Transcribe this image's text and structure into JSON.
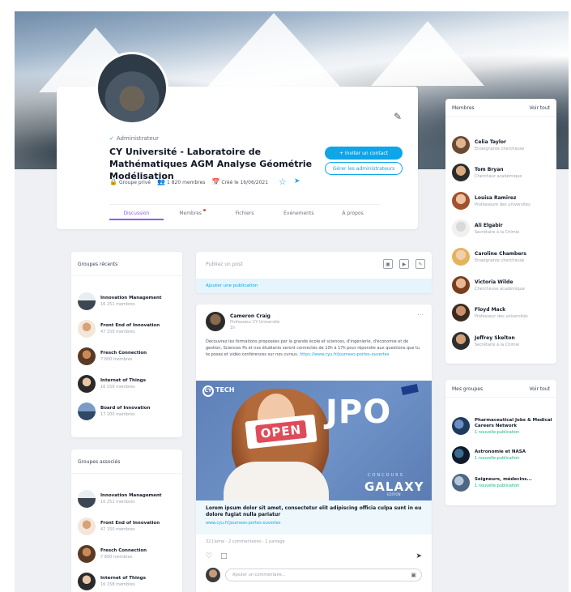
{
  "header": {
    "admin_label": "Administrateur",
    "title": "CY Université - Laboratoire de Mathématiques AGM Analyse Géométrie Modélisation",
    "meta": {
      "privacy": "Groupe privé",
      "members": "1 820 membres",
      "creation": "Créé le 16/06/2021"
    },
    "invite_button": "+ Inviter un contact",
    "admin_button": "Gérer les administrateurs",
    "tabs": [
      "Discussion",
      "Membres",
      "Fichiers",
      "Événements",
      "À propos"
    ]
  },
  "members_card": {
    "title": "Membres",
    "link": "Voir tout",
    "items": [
      {
        "name": "Celia Taylor",
        "role": "Enseignante chercheuse"
      },
      {
        "name": "Tom Bryan",
        "role": "Chercheur académique"
      },
      {
        "name": "Louisa Ramirez",
        "role": "Professeure des universités"
      },
      {
        "name": "Ali Elgabir",
        "role": "Secrétaire à la Chimie"
      },
      {
        "name": "Caroline Chambers",
        "role": "Enseignante chercheuse"
      },
      {
        "name": "Victoria Wilde",
        "role": "Chercheuse académique"
      },
      {
        "name": "Floyd Mack",
        "role": "Professeur des universités"
      },
      {
        "name": "Jeffrey Skelton",
        "role": "Secrétaire à la Chimie"
      }
    ]
  },
  "mygroups_card": {
    "title": "Mes groupes",
    "link": "Voir tout",
    "items": [
      {
        "name": "Pharmaceutical Jobs & Medical Careers Network",
        "sub": "1 nouvelle publication"
      },
      {
        "name": "Astronomie et NASA",
        "sub": "1 nouvelle publication"
      },
      {
        "name": "Seigneurs, médecins...",
        "sub": "1 nouvelle publication"
      }
    ]
  },
  "recent_groups": {
    "title": "Groupes récents",
    "items": [
      {
        "name": "Innovation Management",
        "count": "16 251 membres"
      },
      {
        "name": "Front End of Innovation",
        "count": "47 150 membres"
      },
      {
        "name": "Fresch Connection",
        "count": "7 800 membres"
      },
      {
        "name": "Internet of Things",
        "count": "16 158 membres"
      },
      {
        "name": "Board of Innovation",
        "count": "17 200 membres"
      }
    ]
  },
  "assoc_groups": {
    "title": "Groupes associés",
    "items": [
      {
        "name": "Innovation Management",
        "count": "16 251 membres"
      },
      {
        "name": "Front End of Innovation",
        "count": "47 150 membres"
      },
      {
        "name": "Fresch Connection",
        "count": "7 800 membres"
      },
      {
        "name": "Internet of Things",
        "count": "16 158 membres"
      }
    ]
  },
  "composer": {
    "placeholder": "Publiez un post",
    "action": "Ajouter une publication"
  },
  "post": {
    "author": "Cameron Craig",
    "org": "Professeur CY Université",
    "time": "1h",
    "text": "Découvrez les formations proposées par la grande école et sciences, d'ingénierie, d'économie et de gestion, Sciences Po et nos étudiants seront connectés de 10h à 17h pour répondre aux questions que tu te poses et vidéo conférences sur nos cursus.",
    "url": "https://www.cyu.fr/journees-portes-ouvertes",
    "image": {
      "brand": "TECH",
      "brand_badge": "CY",
      "open_word": "OPEN",
      "jpo": "JPO",
      "concours": "CONCOURS",
      "galaxy": "GALAXY",
      "edition": "EDITION"
    },
    "caption_title": "Lorem ipsum dolor sit amet, consectetur elit adipiscing officia culpa sunt in eu dolore fugiat nulla pariatur",
    "caption_url": "www.cyu.fr/journees-portes-ouvertes",
    "stats": "32 J'aime · 2 commentaires · 1 partage",
    "comment_placeholder": "Ajouter un commentaire..."
  }
}
